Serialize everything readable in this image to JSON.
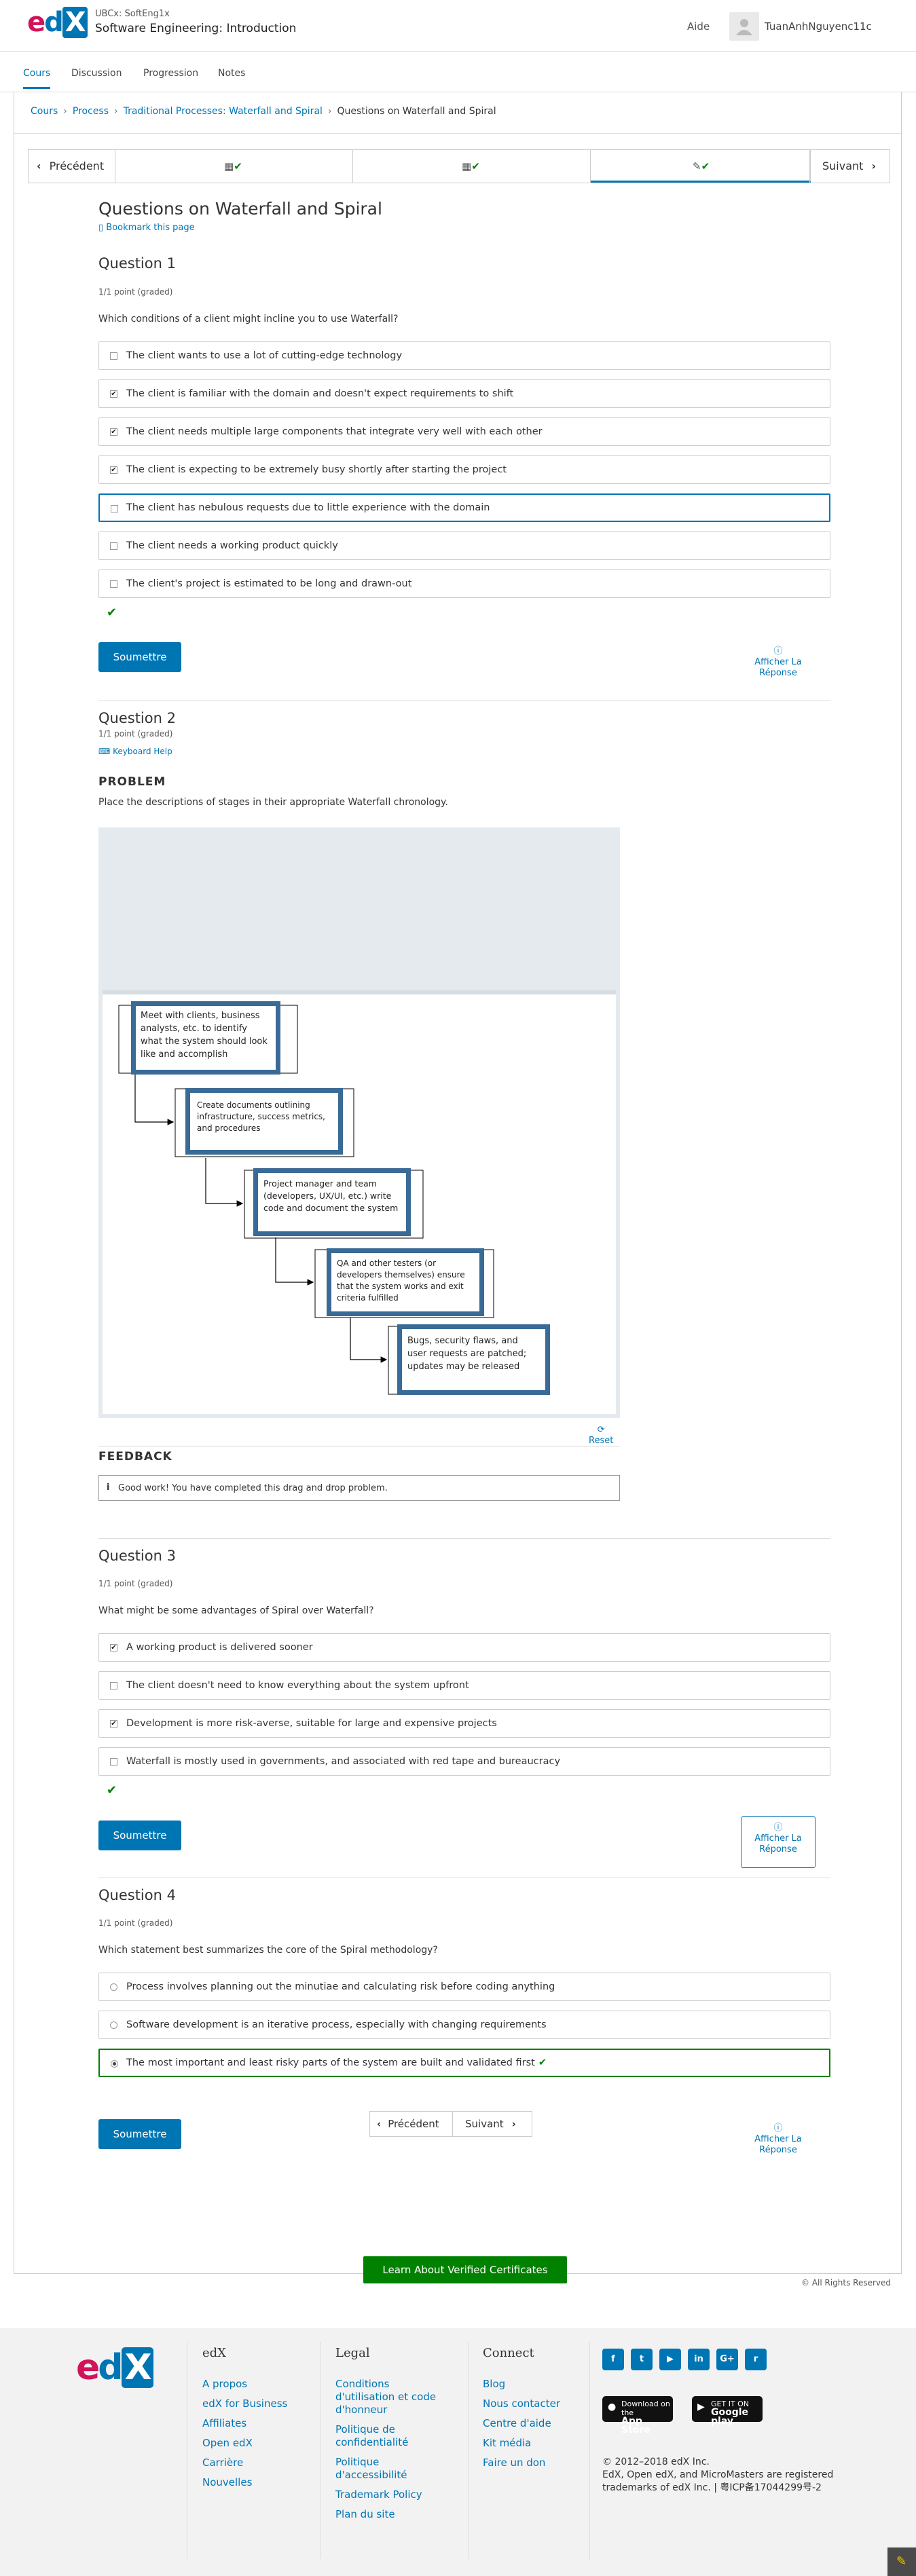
{
  "header": {
    "logo": {
      "e": "e",
      "d": "d",
      "x": "X"
    },
    "course_org": "UBCx: SoftEng1x",
    "course_title": "Software Engineering: Introduction",
    "help": "Aide",
    "username": "TuanAnhNguyenc11c"
  },
  "tabs": [
    "Cours",
    "Discussion",
    "Progression",
    "Notes"
  ],
  "breadcrumb": [
    "Cours",
    "Process",
    "Traditional Processes: Waterfall and Spiral",
    "Questions on Waterfall and Spiral"
  ],
  "sequence": {
    "prev": "Précédent",
    "next": "Suivant"
  },
  "unit": {
    "title": "Questions on Waterfall and Spiral",
    "bookmark": "Bookmark this page"
  },
  "q1": {
    "title": "Question 1",
    "points": "1/1 point (graded)",
    "prompt": "Which conditions of a client might incline you to use Waterfall?",
    "options": [
      {
        "label": "The client wants to use a lot of cutting-edge technology",
        "checked": false
      },
      {
        "label": "The client is familiar with the domain and doesn't expect requirements to shift",
        "checked": true
      },
      {
        "label": "The client needs multiple large components that integrate very well with each other",
        "checked": true
      },
      {
        "label": "The client is expecting to be extremely busy shortly after starting the project",
        "checked": true
      },
      {
        "label": "The client has nebulous requests due to little experience with the domain",
        "checked": false
      },
      {
        "label": "The client needs a working product quickly",
        "checked": false
      },
      {
        "label": "The client's project is estimated to be long and drawn-out",
        "checked": false
      }
    ],
    "submit": "Soumettre",
    "show_answer": "Afficher La Réponse"
  },
  "q2": {
    "title": "Question 2",
    "points": "1/1 point (graded)",
    "keyboard_help": "Keyboard Help",
    "problem_heading": "PROBLEM",
    "prompt": "Place the descriptions of stages in their appropriate Waterfall chronology.",
    "stages": [
      "Meet with clients, business analysts, etc. to identify what the system should look like and accomplish",
      "Create documents outlining infrastructure, success metrics, and procedures",
      "Project manager and team (developers, UX/UI, etc.) write code and document the system",
      "QA and other testers (or developers themselves) ensure that the system works and exit criteria fulfilled",
      "Bugs, security flaws, and user requests are patched; updates may be released"
    ],
    "reset": "Reset",
    "feedback_heading": "FEEDBACK",
    "feedback": "Good work! You have completed this drag and drop problem."
  },
  "q3": {
    "title": "Question 3",
    "points": "1/1 point (graded)",
    "prompt": "What might be some advantages of Spiral over Waterfall?",
    "options": [
      {
        "label": "A working product is delivered sooner",
        "checked": true
      },
      {
        "label": "The client doesn't need to know everything about the system upfront",
        "checked": false
      },
      {
        "label": "Development is more risk-averse, suitable for large and expensive projects",
        "checked": true
      },
      {
        "label": "Waterfall is mostly used in governments, and associated with red tape and bureaucracy",
        "checked": false
      }
    ],
    "submit": "Soumettre",
    "show_answer": "Afficher La Réponse"
  },
  "q4": {
    "title": "Question 4",
    "points": "1/1 point (graded)",
    "prompt": "Which statement best summarizes the core of the Spiral methodology?",
    "options": [
      {
        "label": "Process involves planning out the minutiae and calculating risk before coding anything",
        "selected": false
      },
      {
        "label": "Software development is an iterative process, especially with changing requirements",
        "selected": false
      },
      {
        "label": "The most important and least risky parts of the system are built and validated first",
        "selected": true
      }
    ],
    "submit": "Soumettre",
    "show_answer": "Afficher La Réponse"
  },
  "pager": {
    "prev": "Précédent",
    "next": "Suivant"
  },
  "cert": "Learn About Verified Certificates",
  "rights": "© All Rights Reserved",
  "footer": {
    "edx": {
      "title": "edX",
      "links": [
        "A propos",
        "edX for Business",
        "Affiliates",
        "Open edX",
        "Carrière",
        "Nouvelles"
      ]
    },
    "legal": {
      "title": "Legal",
      "links": [
        "Conditions d'utilisation et code d'honneur",
        "Politique de confidentialité",
        "Politique d'accessibilité",
        "Trademark Policy",
        "Plan du site"
      ]
    },
    "connect": {
      "title": "Connect",
      "links": [
        "Blog",
        "Nous contacter",
        "Centre d'aide",
        "Kit média",
        "Faire un don"
      ]
    },
    "appstore": {
      "small": "Download on the",
      "big": "App Store"
    },
    "googleplay": {
      "small": "GET IT ON",
      "big": "Google play"
    },
    "copyright": "© 2012–2018 edX Inc.",
    "copyright2": "EdX, Open edX, and MicroMasters are registered trademarks of edX Inc. | 粤ICP备17044299号-2"
  },
  "colors": {
    "accent": "#0075b4",
    "success": "#008100",
    "brand_pink": "#d0135a"
  },
  "icons": [
    "chevron-left-icon",
    "chevron-right-icon",
    "video-icon",
    "edit-icon",
    "check-icon",
    "bookmark-icon",
    "keyboard-icon",
    "reset-icon",
    "info-icon",
    "avatar-icon",
    "pencil-icon"
  ]
}
